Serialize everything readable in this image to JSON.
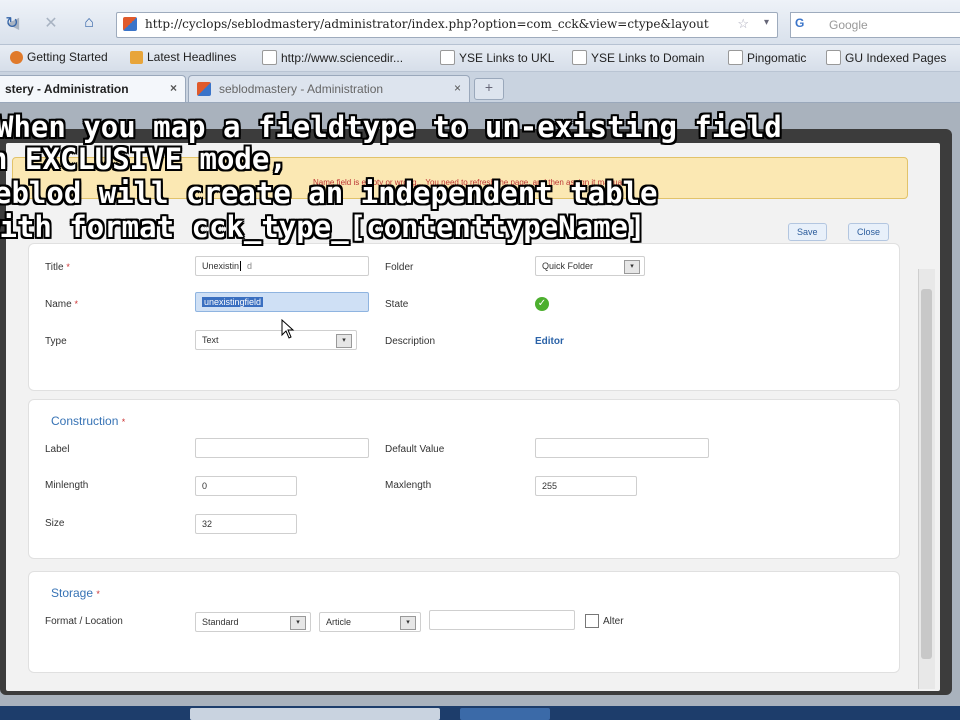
{
  "browser": {
    "url": "http://cyclops/seblodmastery/administrator/index.php?option=com_cck&view=ctype&layout",
    "search_placeholder": "Google",
    "search_icon_letter": "G",
    "bookmarks": [
      "Getting Started",
      "Latest Headlines",
      "http://www.sciencedir...",
      "YSE Links to UKL",
      "YSE Links to Domain",
      "Pingomatic",
      "GU Indexed Pages"
    ],
    "tabs": [
      {
        "label": "stery - Administration",
        "active": true
      },
      {
        "label": "seblodmastery - Administration",
        "active": false
      }
    ],
    "new_tab_label": "+",
    "close_glyph": "×"
  },
  "caption": {
    "lines": [
      "When you map a fieldtype to un-existing field",
      "n EXCLUSIVE mode,",
      "eblod will create an independent table",
      "with format cck_type_[contenttypeName]"
    ]
  },
  "notice": {
    "text": "Name field is empty or wrong... You need to refresh the page, and then assign it manually."
  },
  "buttons": {
    "save": "Save",
    "close": "Close"
  },
  "general": {
    "title_label": "Title",
    "title_value": "Unexistin",
    "title_value_suffix": "d",
    "name_label": "Name",
    "name_value": "unexistingfield",
    "type_label": "Type",
    "type_value": "Text",
    "folder_label": "Folder",
    "folder_value": "Quick Folder",
    "state_label": "State",
    "description_label": "Description",
    "description_link": "Editor",
    "required_mark": "*"
  },
  "construction": {
    "title": "Construction",
    "label_label": "Label",
    "default_value_label": "Default Value",
    "minlength_label": "Minlength",
    "minlength_value": "0",
    "maxlength_label": "Maxlength",
    "maxlength_value": "255",
    "size_label": "Size",
    "size_value": "32"
  },
  "storage": {
    "title": "Storage",
    "format_location_label": "Format / Location",
    "format_value": "Standard",
    "location_value": "Article",
    "alter_label": "Alter"
  },
  "glyphs": {
    "back": "◀",
    "forward": "▶",
    "reload": "↻",
    "stop": "✕",
    "home": "⌂",
    "star": "☆",
    "dropdown": "▾",
    "check": "✓"
  },
  "colors": {
    "accent": "#3773b5",
    "notice_bg": "#fbe8b3",
    "state_green": "#4caf2e"
  }
}
